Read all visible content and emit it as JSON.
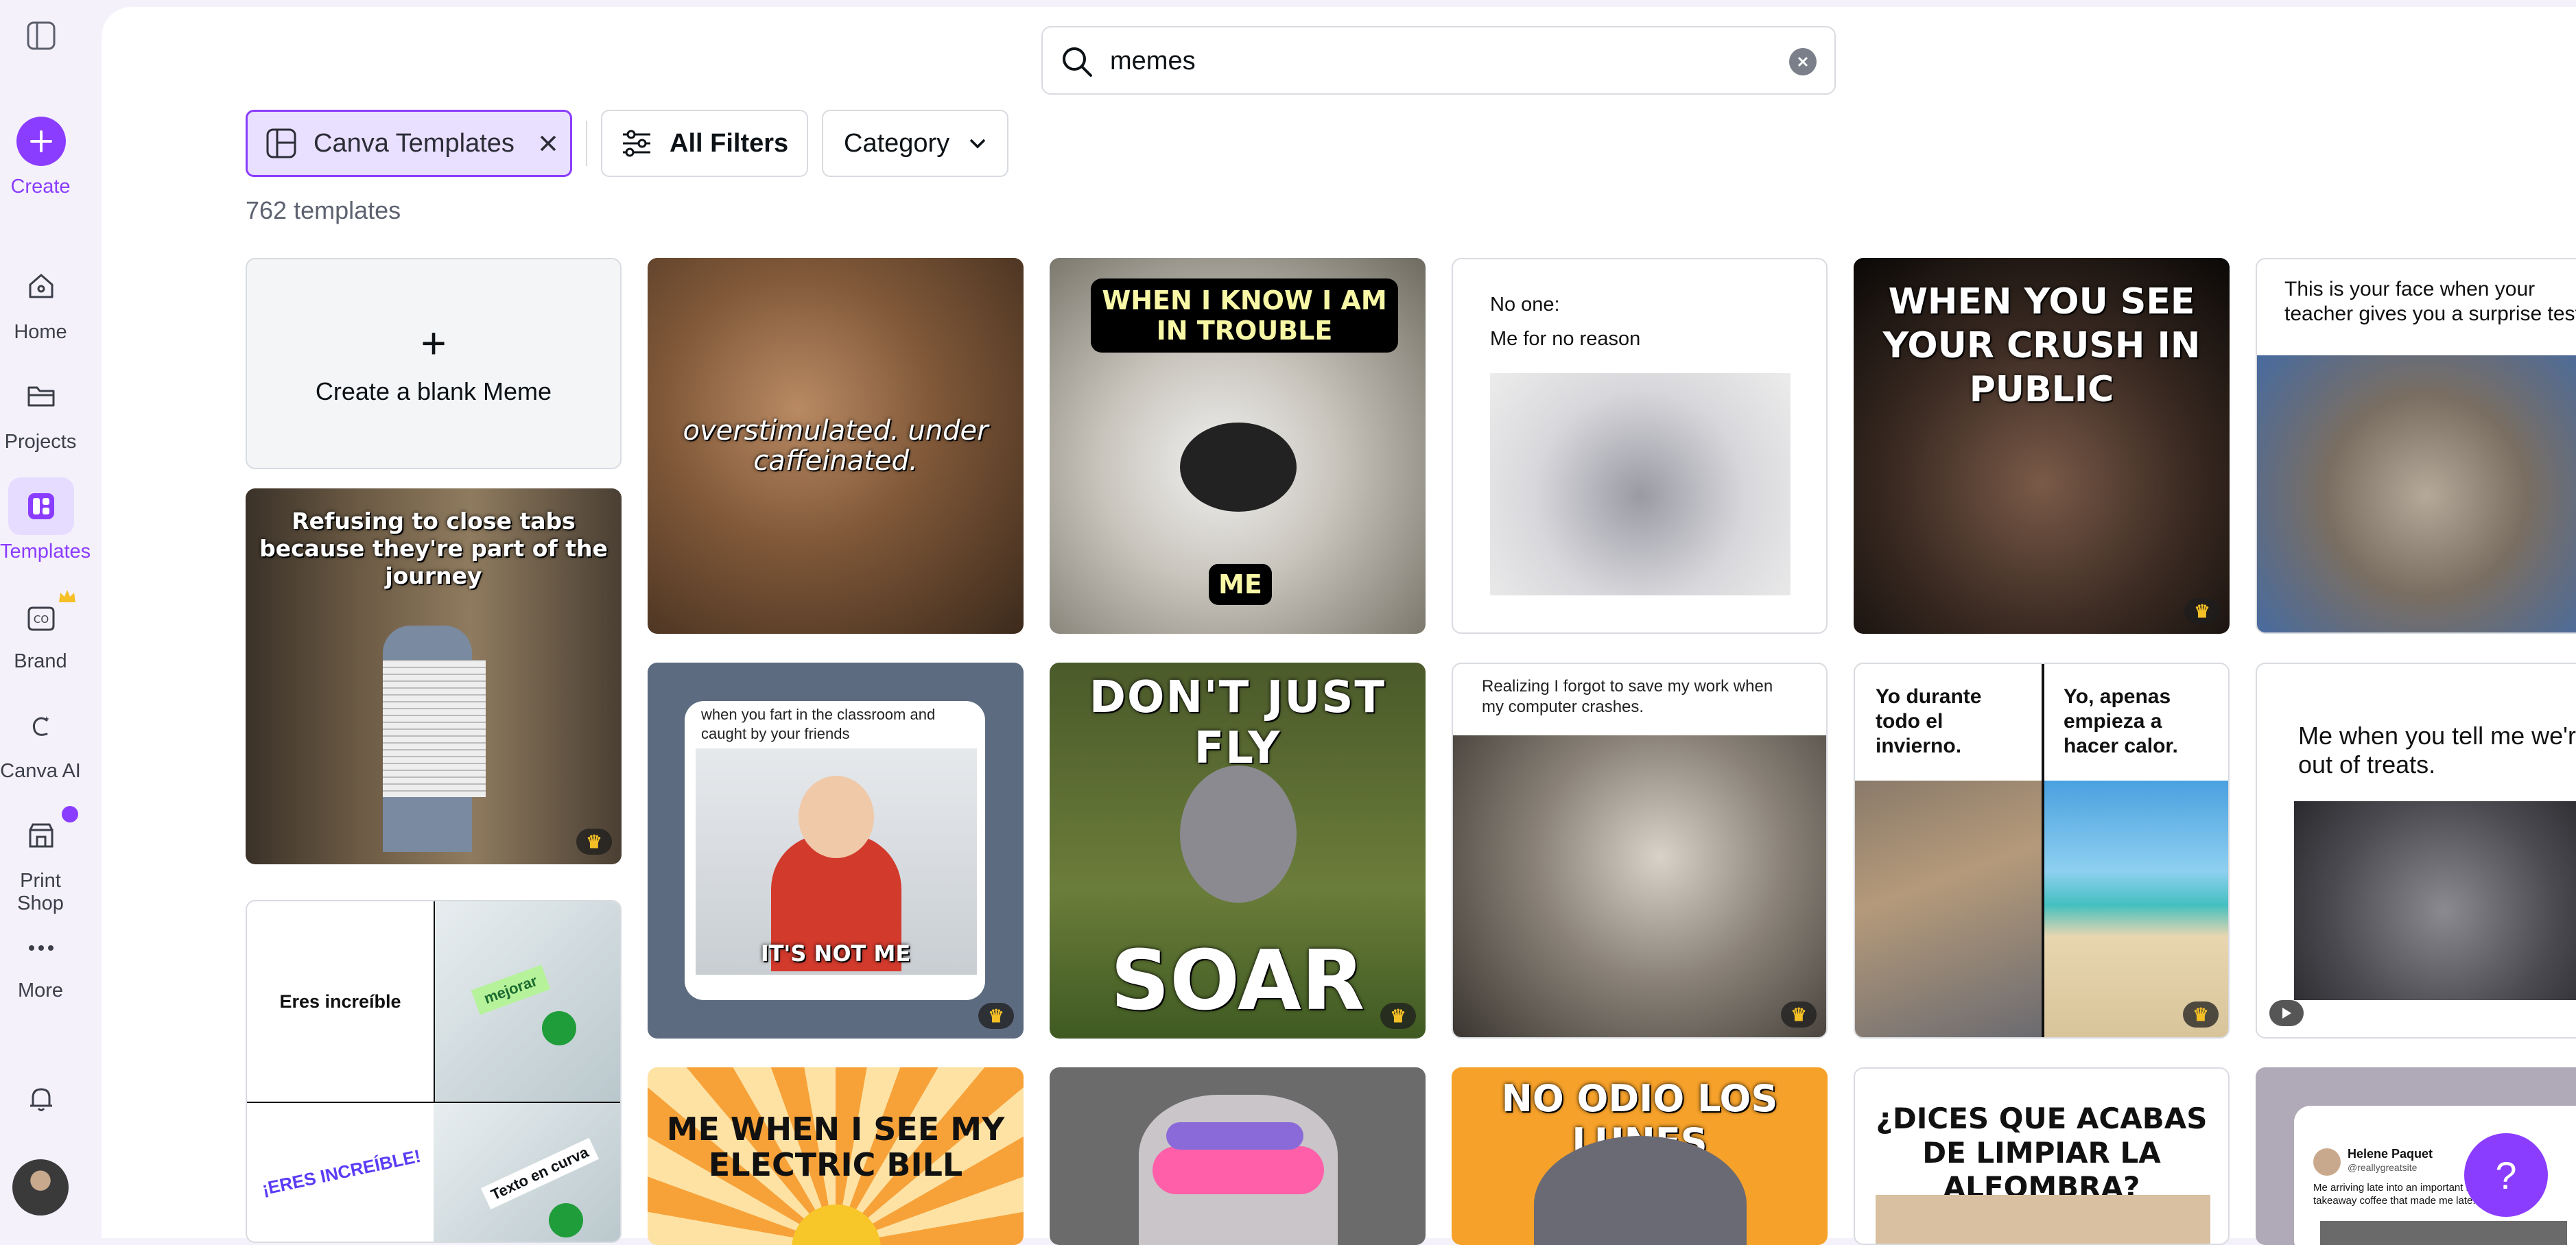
{
  "sidebar": {
    "create_label": "Create",
    "items": [
      {
        "label": "Home",
        "icon": "home-icon"
      },
      {
        "label": "Projects",
        "icon": "folder-icon"
      },
      {
        "label": "Templates",
        "icon": "templates-icon"
      },
      {
        "label": "Brand",
        "icon": "brand-icon"
      },
      {
        "label": "Canva AI",
        "icon": "canva-ai-icon"
      },
      {
        "label": "Print Shop",
        "icon": "print-shop-icon"
      },
      {
        "label": "More",
        "icon": "more-icon"
      }
    ]
  },
  "search": {
    "value": "memes",
    "placeholder": ""
  },
  "filters": {
    "active_chip": "Canva Templates",
    "all_filters": "All Filters",
    "category": "Category"
  },
  "results": {
    "count_text": "762 templates"
  },
  "cards": {
    "blank": {
      "plus": "+",
      "label": "Create a blank Meme"
    },
    "c1": {
      "caption": "overstimulated. under caffeinated."
    },
    "c2": {
      "top": "WHEN I KNOW I AM IN TROUBLE",
      "bottom": "ME"
    },
    "c3": {
      "line1": "No one:",
      "line2": "Me for no reason"
    },
    "c4": {
      "caption": "WHEN YOU SEE YOUR CRUSH IN PUBLIC"
    },
    "c5": {
      "caption": "This is your face when your teacher gives you a surprise test.",
      "badge": "$"
    },
    "c6": {
      "caption": "Refusing to close tabs because they're part of the journey"
    },
    "c7": {
      "caption": "when you fart in the classroom and caught by your friends",
      "bottom": "IT'S NOT ME"
    },
    "c8": {
      "top": "DON'T JUST FLY",
      "bottom": "SOAR"
    },
    "c9": {
      "caption": "Realizing I forgot to save my work when my computer crashes."
    },
    "c10": {
      "left": "Yo durante todo el invierno.",
      "right": "Yo, apenas empieza a hacer calor."
    },
    "c11": {
      "caption": "Me when you tell me we're out of treats."
    },
    "c12": {
      "tl": "Eres increíble",
      "tr": "mejorar",
      "bl": "¡ERES INCREÍBLE!",
      "br": "Texto en curva"
    },
    "c13": {
      "caption": "ME WHEN I SEE MY ELECTRIC BILL"
    },
    "c15": {
      "caption": "NO ODIO LOS LUNES"
    },
    "c16": {
      "caption": "¿DICES QUE ACABAS DE LIMPIAR LA ALFOMBRA?"
    },
    "c17": {
      "name": "Helene Paquet",
      "handle": "@reallygreatsite",
      "text": "Me arriving late into an important meeting, with the takeaway coffee that made me late."
    }
  },
  "help": {
    "label": "?"
  },
  "colors": {
    "accent": "#8b3dff",
    "crown": "#f5c026"
  }
}
